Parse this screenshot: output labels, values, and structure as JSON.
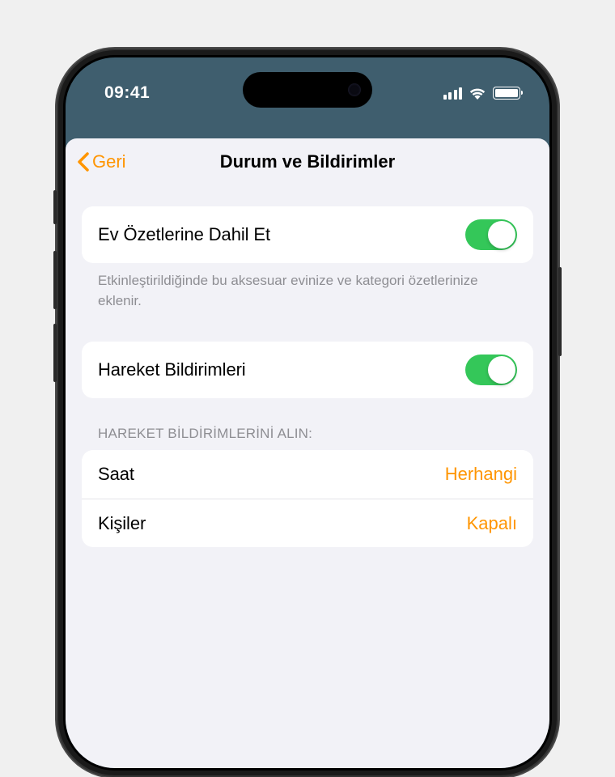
{
  "status": {
    "time": "09:41"
  },
  "nav": {
    "back": "Geri",
    "title": "Durum ve Bildirimler"
  },
  "include": {
    "label": "Ev Özetlerine Dahil Et",
    "on": true,
    "footer": "Etkinleştirildiğinde bu aksesuar evinize ve kategori özetlerinize eklenir."
  },
  "motion": {
    "label": "Hareket Bildirimleri",
    "on": true
  },
  "receive": {
    "header": "HAREKET BİLDİRİMLERİNİ ALIN:",
    "rows": [
      {
        "label": "Saat",
        "value": "Herhangi"
      },
      {
        "label": "Kişiler",
        "value": "Kapalı"
      }
    ]
  },
  "colors": {
    "accent": "#ff9500",
    "switch_on": "#34c759",
    "header_bg": "#3f5e6e"
  }
}
